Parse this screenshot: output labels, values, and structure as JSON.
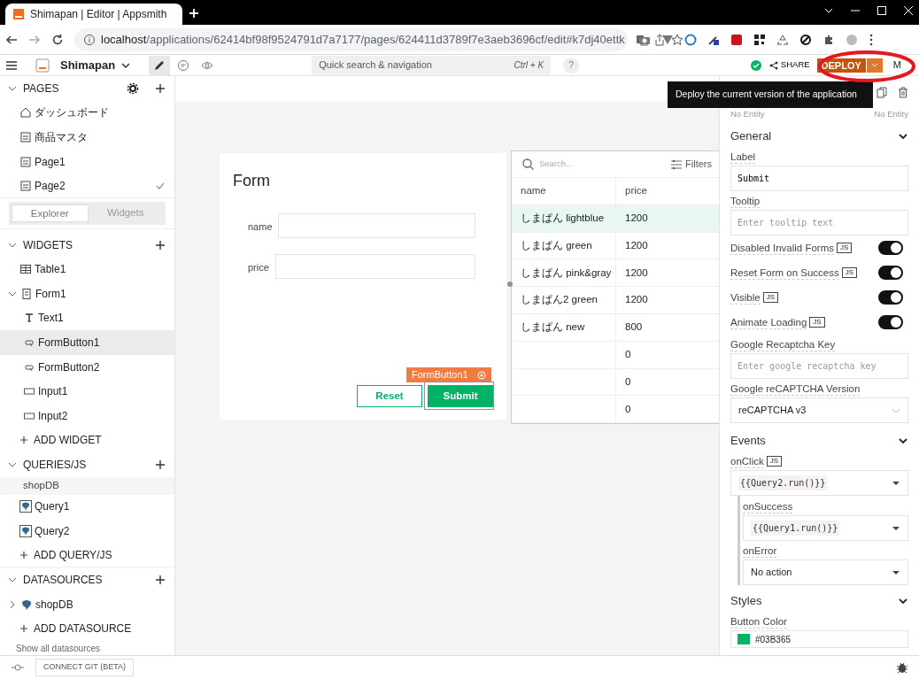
{
  "browser": {
    "tab_title": "Shimapan | Editor | Appsmith",
    "url_host": "localhost",
    "url_path": "/applications/62414bf98f9524791d7a7177/pages/624411d3789f7e3aeb3696cf/edit#k7dj40ettk"
  },
  "header": {
    "app_name": "Shimapan",
    "modes": [
      {
        "kind": "edit",
        "selected": true
      },
      {
        "kind": "comment",
        "selected": false
      },
      {
        "kind": "view",
        "selected": false
      }
    ],
    "search_placeholder": "Quick search & navigation",
    "shortcut": "Ctrl + K",
    "help": "?",
    "share": "SHARE",
    "deploy": "DEPLOY",
    "user_initial": "M"
  },
  "tooltip": "Deploy the current version of the application",
  "sidebar": {
    "pages_title": "PAGES",
    "pages": [
      {
        "label": "ダッシュボード",
        "kind": "home",
        "selected": false
      },
      {
        "label": "商品マスタ",
        "kind": "page",
        "selected": false
      },
      {
        "label": "Page1",
        "kind": "page",
        "selected": false
      },
      {
        "label": "Page2",
        "kind": "page",
        "selected": true
      }
    ],
    "switcher": [
      {
        "label": "Explorer",
        "selected": true
      },
      {
        "label": "Widgets",
        "selected": false
      }
    ],
    "widgets_title": "WIDGETS",
    "widgets": [
      {
        "label": "Table1",
        "kind": "table",
        "selected": false
      },
      {
        "label": "Form1",
        "kind": "form",
        "selected": false,
        "expanded": true,
        "children": [
          {
            "label": "Text1",
            "kind": "text",
            "selected": false
          },
          {
            "label": "FormButton1",
            "kind": "button",
            "selected": true
          },
          {
            "label": "FormButton2",
            "kind": "button",
            "selected": false
          },
          {
            "label": "Input1",
            "kind": "input",
            "selected": false
          },
          {
            "label": "Input2",
            "kind": "input",
            "selected": false
          }
        ]
      }
    ],
    "add_widget": "ADD WIDGET",
    "queries_title": "QUERIES/JS",
    "query_group": "shopDB",
    "queries": [
      {
        "label": "Query1"
      },
      {
        "label": "Query2"
      }
    ],
    "add_query": "ADD QUERY/JS",
    "datasources_title": "DATASOURCES",
    "datasources": [
      {
        "label": "shopDB",
        "expanded": false
      }
    ],
    "add_datasource": "ADD DATASOURCE",
    "show_all": "Show all datasources"
  },
  "canvas": {
    "form": {
      "title": "Form",
      "fields": [
        {
          "label": "name"
        },
        {
          "label": "price"
        }
      ],
      "selected_widget": "FormButton1",
      "buttons": [
        {
          "label": "Reset",
          "kind": "outline"
        },
        {
          "label": "Submit",
          "kind": "solid"
        }
      ]
    },
    "table": {
      "search_placeholder": "Search...",
      "filters": "Filters",
      "columns": [
        "name",
        "price"
      ],
      "rows": [
        {
          "name": "しまぱん lightblue",
          "price": "1200",
          "selected": true
        },
        {
          "name": "しまぱん green",
          "price": "1200",
          "selected": false
        },
        {
          "name": "しまぱん pink&gray",
          "price": "1200",
          "selected": false
        },
        {
          "name": "しまぱん2 green",
          "price": "1200",
          "selected": false
        },
        {
          "name": "しまぱん new",
          "price": "800",
          "selected": false
        },
        {
          "price": "0",
          "selected": false
        },
        {
          "price": "0",
          "selected": false
        },
        {
          "price": "0",
          "selected": false
        }
      ]
    }
  },
  "properties": {
    "entity_links": [
      "No Entity",
      "No Entity"
    ],
    "general_title": "General",
    "label_field": {
      "label": "Label",
      "value": "Submit"
    },
    "tooltip_field": {
      "label": "Tooltip",
      "placeholder": "Enter tooltip text"
    },
    "toggles": [
      {
        "label": "Disabled Invalid Forms",
        "js": "JS",
        "on": true
      },
      {
        "label": "Reset Form on Success",
        "js": "JS",
        "on": true
      },
      {
        "label": "Visible",
        "js": "JS",
        "on": true
      },
      {
        "label": "Animate Loading",
        "js": "JS",
        "on": true
      }
    ],
    "recaptcha_key": {
      "label": "Google Recaptcha Key",
      "placeholder": "Enter google recaptcha key"
    },
    "recaptcha_version": {
      "label": "Google reCAPTCHA Version",
      "value": "reCAPTCHA v3"
    },
    "events_title": "Events",
    "on_click": {
      "label": "onClick",
      "js": "JS",
      "value": "{{Query2.run()}}"
    },
    "on_success": {
      "label": "onSuccess",
      "value": "{{Query1.run()}}"
    },
    "on_error": {
      "label": "onError",
      "value": "No action"
    },
    "styles_title": "Styles",
    "button_color": {
      "label": "Button Color",
      "value": "#03B365",
      "color": "#03b365"
    }
  },
  "footer": {
    "connect_git": "CONNECT GIT (BETA)"
  }
}
